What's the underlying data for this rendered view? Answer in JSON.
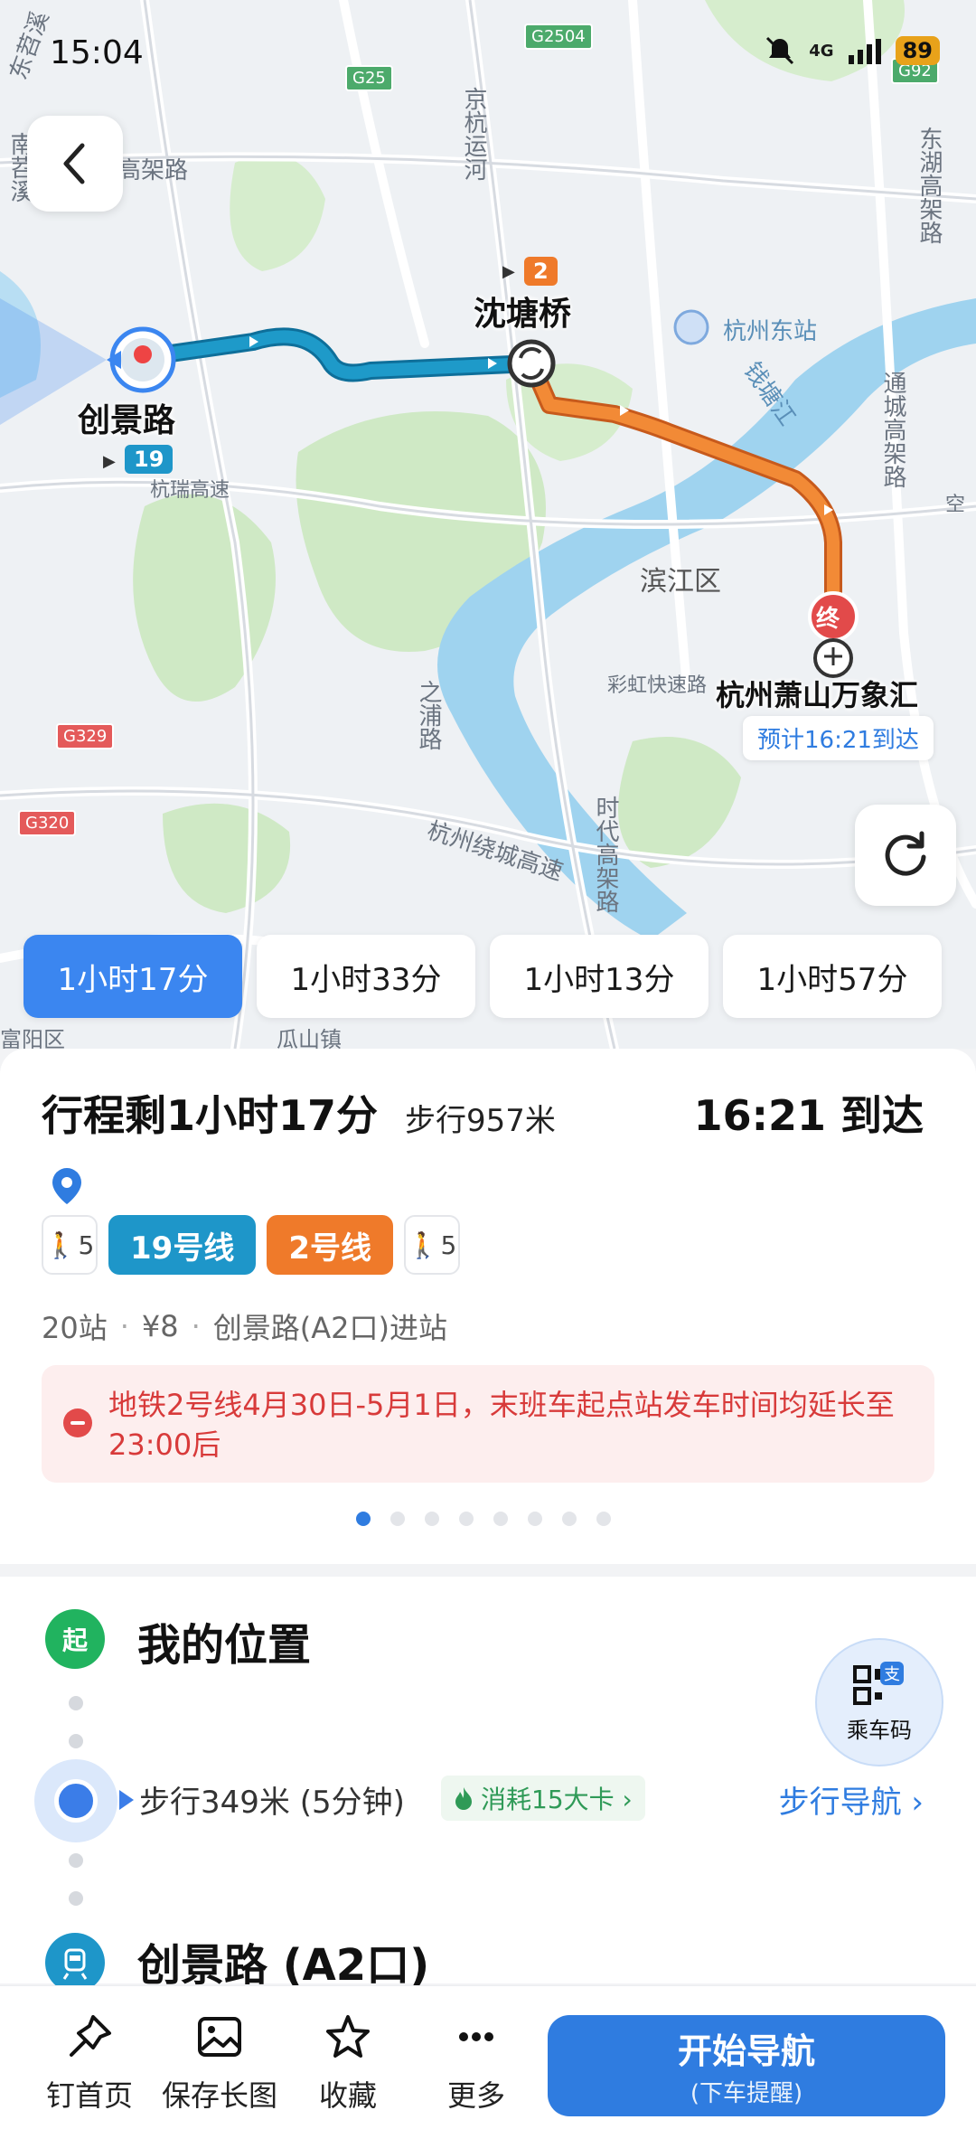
{
  "status_bar": {
    "time": "15:04",
    "network": "4G",
    "battery": "89"
  },
  "colors": {
    "accent": "#2f7ce0",
    "line19": "#1e96c9",
    "line2": "#ef7a2a",
    "start_green": "#21b35f",
    "alert_red": "#d83a3a"
  },
  "map": {
    "labels": {
      "dongtiao": "东苕溪",
      "nanshao": "南苕溪",
      "gaoke": "高架路",
      "jinghang": "京杭运河",
      "hz_east": "杭州东站",
      "qiantang": "钱塘江",
      "dongxi": "东湖高架路",
      "tongcheng": "通城高架路",
      "binjiang": "滨江区",
      "caihong": "彩虹快速路",
      "zhipu": "之浦路",
      "raocheng": "杭州绕城高速",
      "shidai": "时代高架路",
      "hangrui": "杭瑞高速",
      "kong": "空",
      "guashan": "瓜山镇",
      "bottom_left": "富阳区"
    },
    "highways": [
      "G25",
      "G2504",
      "G92",
      "G329",
      "G320"
    ],
    "start_station": "创景路",
    "start_line": "19",
    "transfer_station": "沈塘桥",
    "transfer_line": "2",
    "end_marker": "终",
    "end_station": "杭州萧山万象汇",
    "eta": "预计16:21到达"
  },
  "route_tabs": [
    "1小时17分",
    "1小时33分",
    "1小时13分",
    "1小时57分"
  ],
  "summary": {
    "trip": "行程剩1小时17分",
    "walk": "步行957米",
    "arrive": "16:21 到达",
    "segments": {
      "walk_start": "5",
      "line19": "19号线",
      "line2": "2号线",
      "walk_end": "5"
    },
    "meta": {
      "stops": "20站",
      "fare": "¥8",
      "entrance": "创景路(A2口)进站"
    },
    "notice": "地铁2号线4月30日-5月1日，末班车起点站发车时间均延长至23:00后",
    "pages": 8,
    "active_page": 1
  },
  "steps": {
    "start_badge": "起",
    "start": "我的位置",
    "walk": "步行349米 (5分钟)",
    "calories": "消耗15大卡 ›",
    "walk_nav": "步行导航 ›",
    "ride_code": "乘车码",
    "station": "创景路 (A2口)"
  },
  "bottom_bar": {
    "pin": "钉首页",
    "save": "保存长图",
    "favorite": "收藏",
    "more": "更多",
    "start_nav": "开始导航",
    "start_nav_sub": "(下车提醒)"
  }
}
